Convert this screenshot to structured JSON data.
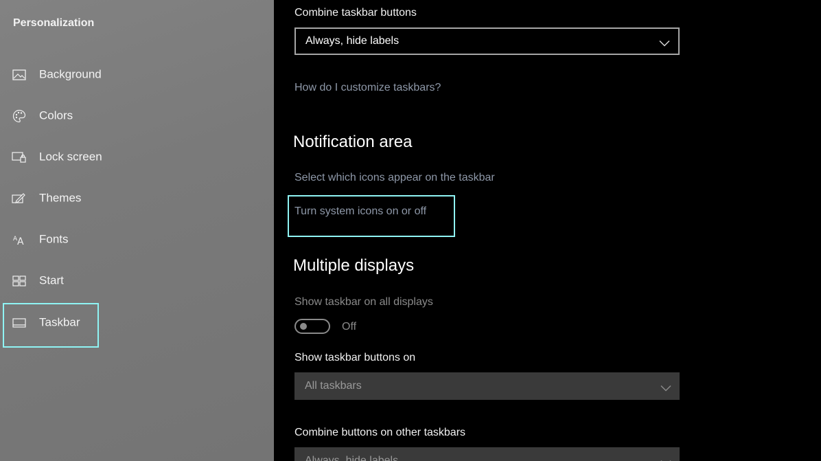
{
  "sidebar": {
    "title": "Personalization",
    "items": [
      {
        "label": "Background",
        "icon": "image-icon"
      },
      {
        "label": "Colors",
        "icon": "palette-icon"
      },
      {
        "label": "Lock screen",
        "icon": "lock-screen-icon"
      },
      {
        "label": "Themes",
        "icon": "themes-icon"
      },
      {
        "label": "Fonts",
        "icon": "fonts-icon"
      },
      {
        "label": "Start",
        "icon": "start-icon"
      },
      {
        "label": "Taskbar",
        "icon": "taskbar-icon"
      }
    ],
    "selected": "Taskbar"
  },
  "main": {
    "combine_label": "Combine taskbar buttons",
    "combine_value": "Always, hide labels",
    "customize_link": "How do I customize taskbars?",
    "notification_heading": "Notification area",
    "select_icons_link": "Select which icons appear on the taskbar",
    "system_icons_link": "Turn system icons on or off",
    "multiple_heading": "Multiple displays",
    "show_all_label": "Show taskbar on all displays",
    "show_all_state": "Off",
    "show_buttons_label": "Show taskbar buttons on",
    "show_buttons_value": "All taskbars",
    "combine_other_label": "Combine buttons on other taskbars",
    "combine_other_value": "Always, hide labels"
  },
  "colors": {
    "highlight": "#8ff4f4",
    "link": "#8e98a8",
    "sidebar_bg": "#7a7a7a"
  }
}
